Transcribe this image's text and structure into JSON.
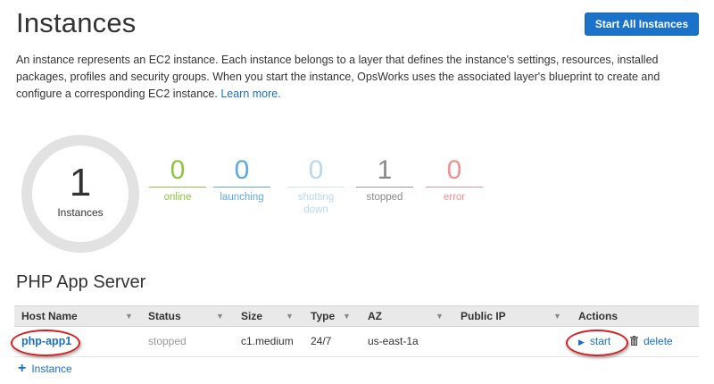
{
  "page": {
    "title": "Instances",
    "start_all_label": "Start All Instances",
    "description": "An instance represents an EC2 instance. Each instance belongs to a layer that defines the instance's settings, resources, installed packages, profiles and security groups. When you start the instance, OpsWorks uses the associated layer's blueprint to create and configure a corresponding EC2 instance.",
    "learn_more": "Learn more."
  },
  "summary": {
    "total": "1",
    "total_label": "Instances",
    "stats": [
      {
        "value": "0",
        "label": "online",
        "color": "#8cc63f"
      },
      {
        "value": "0",
        "label": "launching",
        "color": "#5fa8e0"
      },
      {
        "value": "0",
        "label": "shutting down",
        "color": "#b8d8f0"
      },
      {
        "value": "1",
        "label": "stopped",
        "color": "#888888"
      },
      {
        "value": "0",
        "label": "error",
        "color": "#f09090"
      }
    ]
  },
  "layer": {
    "name": "PHP App Server",
    "columns": [
      "Host Name",
      "Status",
      "Size",
      "Type",
      "AZ",
      "Public IP",
      "Actions"
    ],
    "rows": [
      {
        "host": "php-app1",
        "status": "stopped",
        "size": "c1.medium",
        "type": "24/7",
        "az": "us-east-1a",
        "public_ip": "",
        "action_start": "start",
        "action_delete": "delete"
      }
    ],
    "add_instance_label": "Instance"
  },
  "colors": {
    "accent": "#1a73c9",
    "link": "#1a6fc0",
    "highlight_oval": "#d42020"
  }
}
